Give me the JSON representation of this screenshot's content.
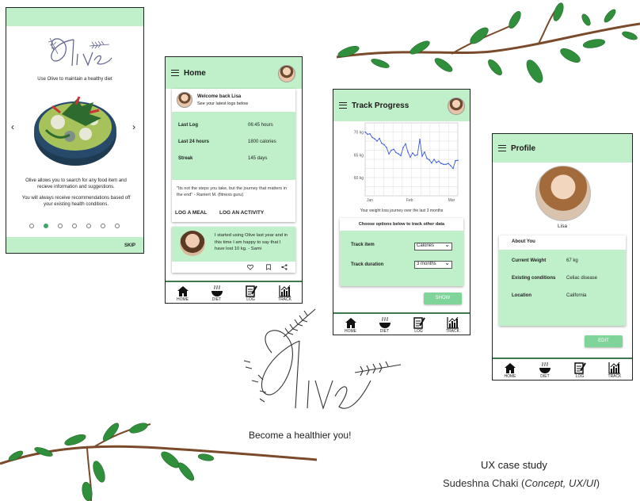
{
  "onboarding": {
    "logo_text": "Olive",
    "tagline": "Use Olive to maintain a healthy diet",
    "description1": "Olive allows you to search for any food item and recieve information and suggestions.",
    "description2": "You will always receive recommendations based off your existing health conditions.",
    "skip_label": "SKIP",
    "prev_icon": "‹",
    "next_icon": "›",
    "dots_count": 7,
    "active_dot": 1
  },
  "home": {
    "title": "Home",
    "welcome": "Welcome back Lisa",
    "welcome_sub": "See your latest logs below",
    "logs": [
      {
        "label": "Last Log",
        "value": "06:45 hours"
      },
      {
        "label": "Last 24 hours",
        "value": "1800 calories"
      },
      {
        "label": "Streak",
        "value": "145 days"
      }
    ],
    "quote": "\"Its not the steps you take, but the journey that matters in the end\" - Raniert M. (fitness guru)",
    "log_meal": "LOG A MEAL",
    "log_activity": "LOG AN ACTIVITY",
    "testimonial": "I started using Olive last  year and in this time I am happy to say that I have lost 10 kg. - Sami"
  },
  "track": {
    "title": "Track Progress",
    "caption": "Your weight loss journey over the last 3 months",
    "options_title": "Choose options below to track other data",
    "item_label": "Track item",
    "item_value": "Calories",
    "duration_label": "Track duration",
    "duration_value": "3 months",
    "show_label": "SHOW"
  },
  "profile": {
    "title": "Profile",
    "name": "Lisa",
    "about_title": "About You",
    "fields": [
      {
        "label": "Current Weight",
        "value": "67 kg"
      },
      {
        "label": "Existing conditions",
        "value": "Celiac disease"
      },
      {
        "label": "Location",
        "value": "California"
      }
    ],
    "edit_label": "EDIT"
  },
  "nav": [
    "HOME",
    "DIET",
    "LOG",
    "TRACK"
  ],
  "branding": {
    "logo_text": "Olive",
    "tagline": "Become a healthier you!",
    "case_study": "UX case study",
    "author": "Sudeshna Chaki",
    "role": "Concept, UX/UI"
  },
  "chart_data": {
    "type": "line",
    "title": "",
    "xlabel": "",
    "ylabel": "",
    "x_ticks": [
      "Jan",
      "Feb",
      "Mar"
    ],
    "y_ticks": [
      "70 kg",
      "65 kg",
      "60 kg"
    ],
    "ylim": [
      56,
      72
    ],
    "grid": true,
    "series": [
      {
        "name": "",
        "values": [
          70,
          69.5,
          69.6,
          68.8,
          68.5,
          68,
          68.6,
          67.5,
          67.2,
          66.6,
          65.2,
          66.0,
          66.2,
          65.5,
          65.2,
          64.8,
          66.6,
          67.4,
          65.6,
          64.5,
          65.4,
          64.8,
          65.0,
          68.4,
          64.7,
          65.6,
          64.2,
          63.9,
          63.2,
          64.0,
          63.3,
          63.6,
          63.1,
          62.9,
          62.9,
          63.1,
          62.6,
          62.0,
          63.7,
          63.8
        ]
      }
    ],
    "colors": {
      "line": "#3b5bdb",
      "grid": "#dddddd"
    }
  },
  "colors": {
    "accent": "#bff0c9",
    "button": "#7fd49a",
    "border": "#3d7a4d"
  }
}
